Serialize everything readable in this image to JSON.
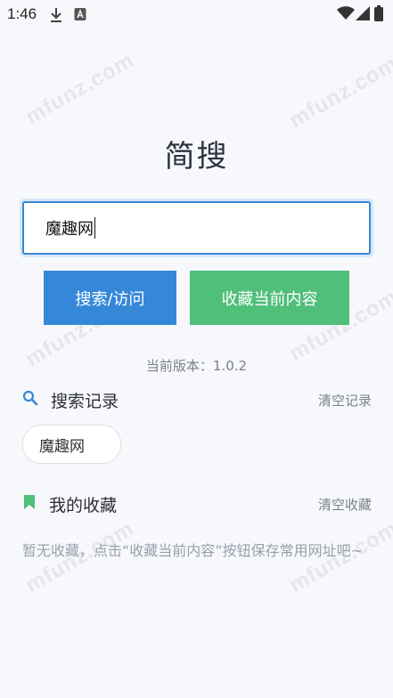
{
  "status_bar": {
    "time": "1:46"
  },
  "watermark": {
    "text": "mfunz.com"
  },
  "app": {
    "title": "简搜"
  },
  "search": {
    "value": "魔趣网"
  },
  "buttons": {
    "search_label": "搜索/访问",
    "favorite_label": "收藏当前内容"
  },
  "version": {
    "text": "当前版本：1.0.2"
  },
  "history": {
    "title": "搜索记录",
    "clear_label": "清空记录",
    "items": [
      "魔趣网"
    ]
  },
  "favorites": {
    "title": "我的收藏",
    "clear_label": "清空收藏",
    "empty_text": "暂无收藏，点击“收藏当前内容”按钮保存常用网址吧~"
  },
  "colors": {
    "primary": "#3588d8",
    "success": "#4fbf7a",
    "background": "#f7f8fc"
  },
  "icons": {
    "history": "search-icon",
    "favorites": "bookmark-icon"
  }
}
